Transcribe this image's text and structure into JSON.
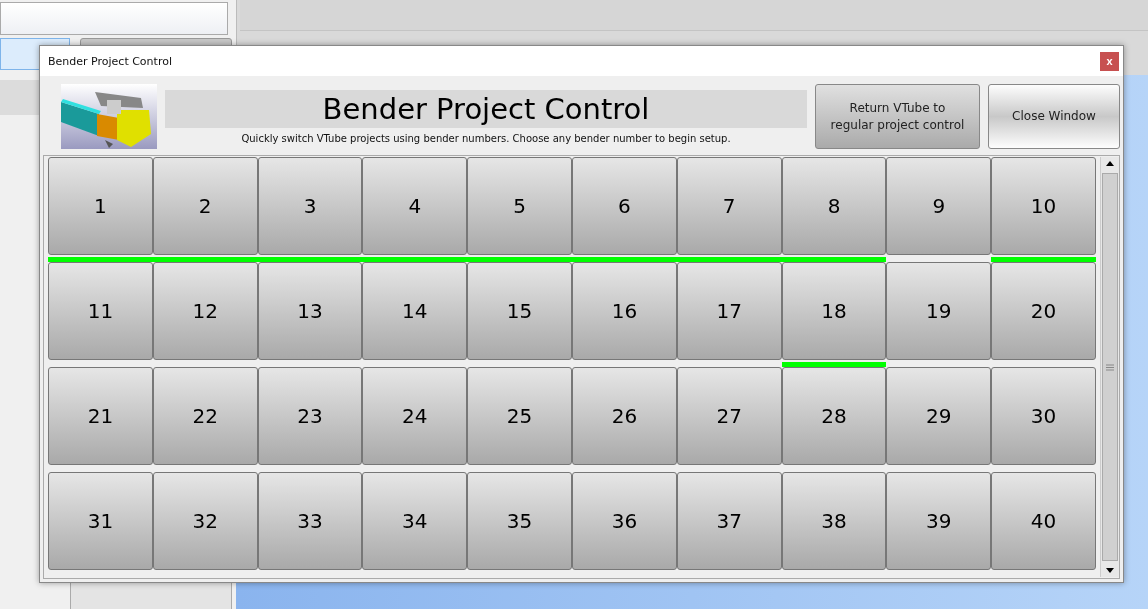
{
  "window": {
    "title": "Bender Project Control",
    "close": "x"
  },
  "header": {
    "heading": "Bender Project Control",
    "subtitle": "Quickly switch VTube projects using bender numbers. Choose any bender number to begin setup.",
    "buttons": [
      "Return VTube to\nregular project control",
      "Close Window"
    ]
  },
  "benders": [
    {
      "label": "1",
      "configured": true
    },
    {
      "label": "2",
      "configured": true
    },
    {
      "label": "3",
      "configured": true
    },
    {
      "label": "4",
      "configured": true
    },
    {
      "label": "5",
      "configured": true
    },
    {
      "label": "6",
      "configured": true
    },
    {
      "label": "7",
      "configured": true
    },
    {
      "label": "8",
      "configured": true
    },
    {
      "label": "9",
      "configured": false
    },
    {
      "label": "10",
      "configured": true
    },
    {
      "label": "11",
      "configured": false
    },
    {
      "label": "12",
      "configured": false
    },
    {
      "label": "13",
      "configured": false
    },
    {
      "label": "14",
      "configured": false
    },
    {
      "label": "15",
      "configured": false
    },
    {
      "label": "16",
      "configured": false
    },
    {
      "label": "17",
      "configured": false
    },
    {
      "label": "18",
      "configured": true
    },
    {
      "label": "19",
      "configured": false
    },
    {
      "label": "20",
      "configured": false
    },
    {
      "label": "21",
      "configured": false
    },
    {
      "label": "22",
      "configured": false
    },
    {
      "label": "23",
      "configured": false
    },
    {
      "label": "24",
      "configured": false
    },
    {
      "label": "25",
      "configured": false
    },
    {
      "label": "26",
      "configured": false
    },
    {
      "label": "27",
      "configured": false
    },
    {
      "label": "28",
      "configured": false
    },
    {
      "label": "29",
      "configured": false
    },
    {
      "label": "30",
      "configured": false
    },
    {
      "label": "31",
      "configured": false
    },
    {
      "label": "32",
      "configured": false
    },
    {
      "label": "33",
      "configured": false
    },
    {
      "label": "34",
      "configured": false
    },
    {
      "label": "35",
      "configured": false
    },
    {
      "label": "36",
      "configured": false
    },
    {
      "label": "37",
      "configured": false
    },
    {
      "label": "38",
      "configured": false
    },
    {
      "label": "39",
      "configured": false
    },
    {
      "label": "40",
      "configured": false
    }
  ]
}
